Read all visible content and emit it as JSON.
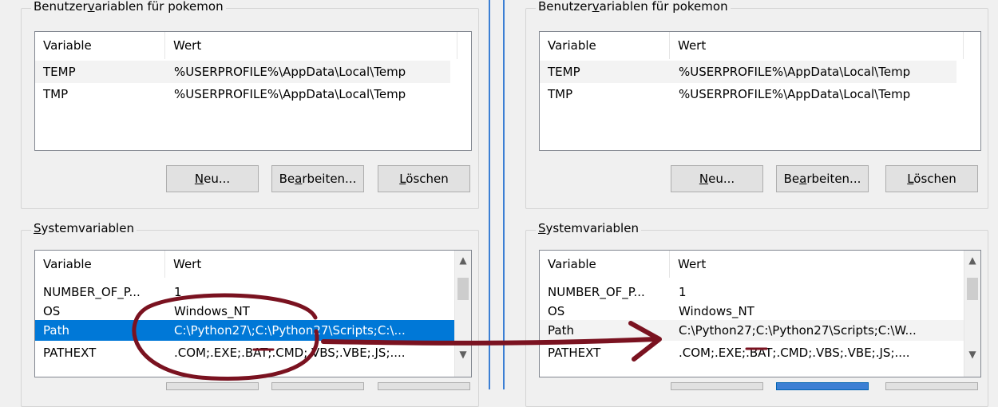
{
  "user_vars": {
    "title_prefix": "Benutzer",
    "title_mnemonic": "v",
    "title_suffix": "ariablen für pokemon",
    "headers": [
      "Variable",
      "Wert"
    ],
    "rows": [
      {
        "name": "TEMP",
        "value": "%USERPROFILE%\\AppData\\Local\\Temp"
      },
      {
        "name": "TMP",
        "value": "%USERPROFILE%\\AppData\\Local\\Temp"
      }
    ],
    "buttons": {
      "new": {
        "mnemonic": "N",
        "rest": "eu..."
      },
      "edit": {
        "pre": "Be",
        "mnemonic": "a",
        "rest": "rbeiten..."
      },
      "delete": {
        "pre": "",
        "mnemonic": "L",
        "rest": "öschen"
      }
    }
  },
  "system_vars": {
    "title_mnemonic": "S",
    "title_rest": "ystemvariablen",
    "headers": [
      "Variable",
      "Wert"
    ],
    "left_rows": [
      {
        "name": "NUMBER_OF_P...",
        "value": "1"
      },
      {
        "name": "OS",
        "value": "Windows_NT"
      },
      {
        "name": "Path",
        "value": "C:\\Python27\\;C:\\Python27\\Scripts;C:\\..."
      },
      {
        "name": "PATHEXT",
        "value": ".COM;.EXE;.BAT;.CMD;.VBS;.VBE;.JS;...."
      }
    ],
    "right_rows": [
      {
        "name": "NUMBER_OF_P...",
        "value": "1"
      },
      {
        "name": "OS",
        "value": "Windows_NT"
      },
      {
        "name": "Path",
        "value": "C:\\Python27;C:\\Python27\\Scripts;C:\\W..."
      },
      {
        "name": "PATHEXT",
        "value": ".COM;.EXE;.BAT;.CMD;.VBS;.VBE;.JS;...."
      }
    ],
    "scroll_up_icon": "chevron-up",
    "scroll_down_icon": "chevron-down"
  },
  "annotation": {
    "color": "#7a1220",
    "description_icon": "arrow-right-annotation"
  },
  "colors": {
    "selection": "#0078d7",
    "divider": "#3c7fd4"
  }
}
